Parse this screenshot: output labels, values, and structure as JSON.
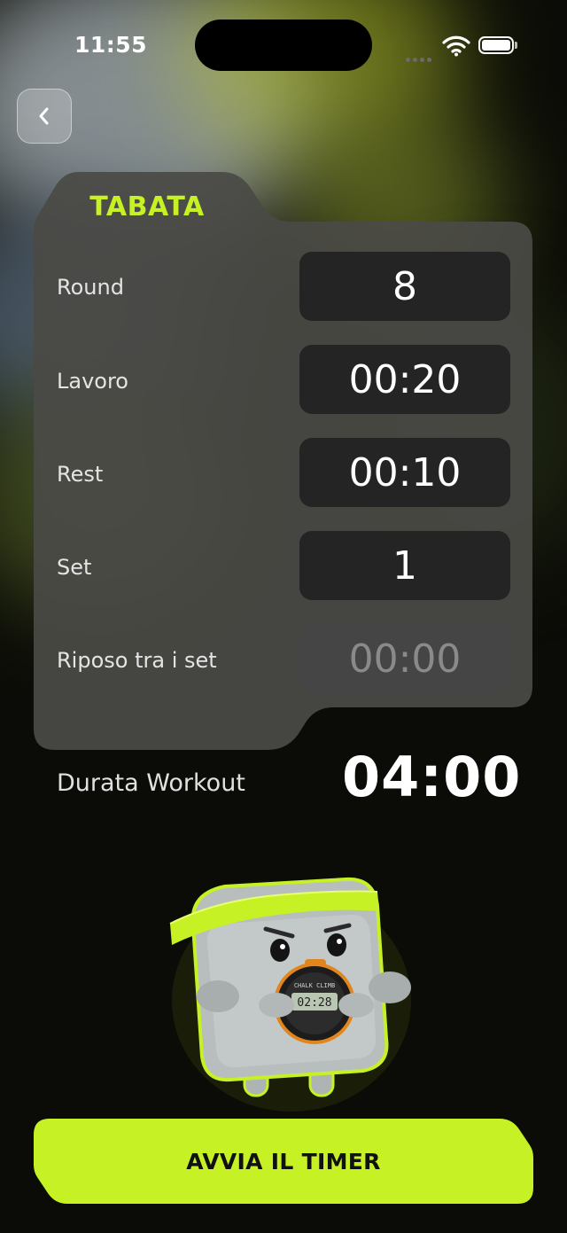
{
  "status_bar": {
    "time": "11:55"
  },
  "back_button": {
    "icon": "chevron-left-icon"
  },
  "card": {
    "title": "TABATA",
    "rows": [
      {
        "label": "Round",
        "value": "8",
        "enabled": true
      },
      {
        "label": "Lavoro",
        "value": "00:20",
        "enabled": true
      },
      {
        "label": "Rest",
        "value": "00:10",
        "enabled": true
      },
      {
        "label": "Set",
        "value": "1",
        "enabled": true
      },
      {
        "label": "Riposo tra i set",
        "value": "00:00",
        "enabled": false
      }
    ]
  },
  "duration": {
    "label": "Durata Workout",
    "value": "04:00"
  },
  "mascot": {
    "timer_brand": "CHALK CLIMB",
    "timer_reading": "02:28"
  },
  "start_button": {
    "label": "AVVIA IL TIMER"
  },
  "colors": {
    "accent": "#c6f125",
    "card_bg": "#4a4a46",
    "value_bg": "#242424",
    "background": "#0b0c07"
  }
}
